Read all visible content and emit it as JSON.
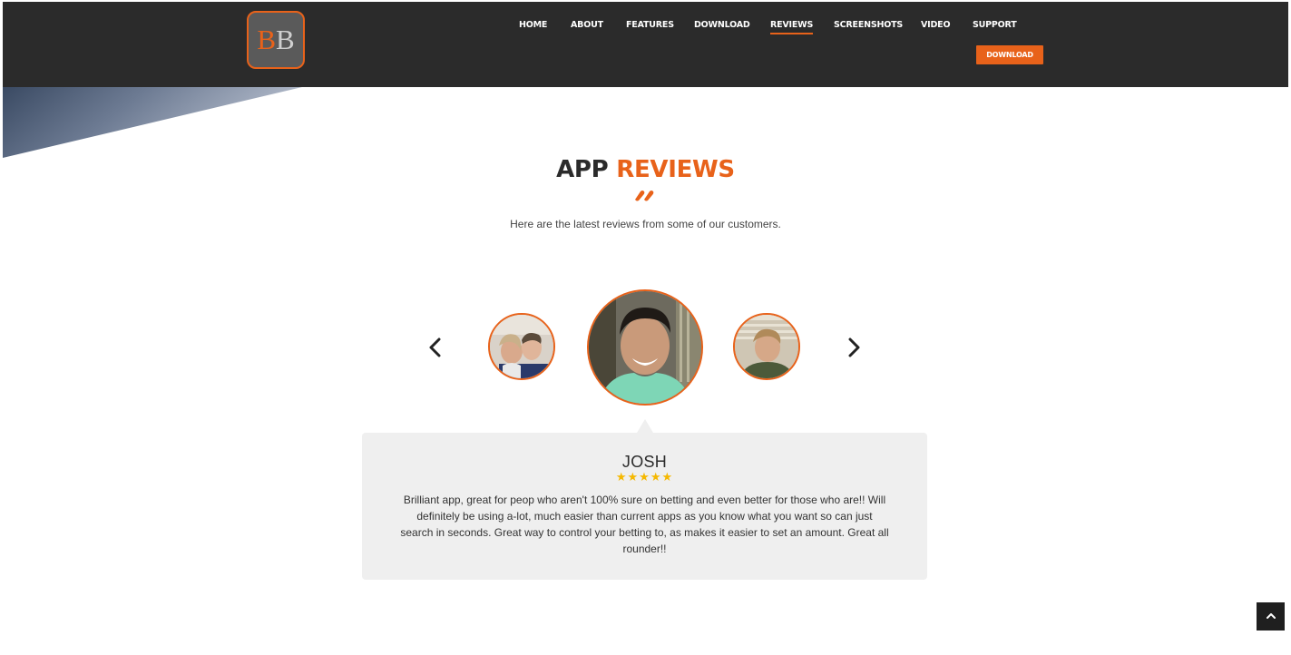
{
  "logo": {
    "letter1": "B",
    "letter2": "B"
  },
  "nav": {
    "items": [
      {
        "label": "HOME"
      },
      {
        "label": "ABOUT"
      },
      {
        "label": "FEATURES"
      },
      {
        "label": "DOWNLOAD"
      },
      {
        "label": "REVIEWS",
        "active": true
      },
      {
        "label": "SCREENSHOTS"
      },
      {
        "label": "VIDEO"
      },
      {
        "label": "SUPPORT"
      }
    ],
    "download_button": "DOWNLOAD"
  },
  "reviews": {
    "title_part1": "APP",
    "title_part2": "REVIEWS",
    "subtitle": "Here are the latest reviews from some of our customers.",
    "active_review": {
      "name": "JOSH",
      "stars_text": "★★★★★",
      "rating": 5,
      "text": "Brilliant app, great for peop who aren't 100% sure on betting and even better for those who are!! Will definitely be using a-lot, much easier than current apps as you know what you want so can just search in seconds. Great way to control your betting to, as makes it easier to set an amount. Great all rounder!!"
    }
  },
  "colors": {
    "accent": "#e8621a",
    "header_bg": "#2b2b2b",
    "card_bg": "#efefef",
    "star": "#f5b800"
  },
  "icons": {
    "prev": "chevron-left-icon",
    "next": "chevron-right-icon",
    "to_top": "chevron-up-icon"
  }
}
